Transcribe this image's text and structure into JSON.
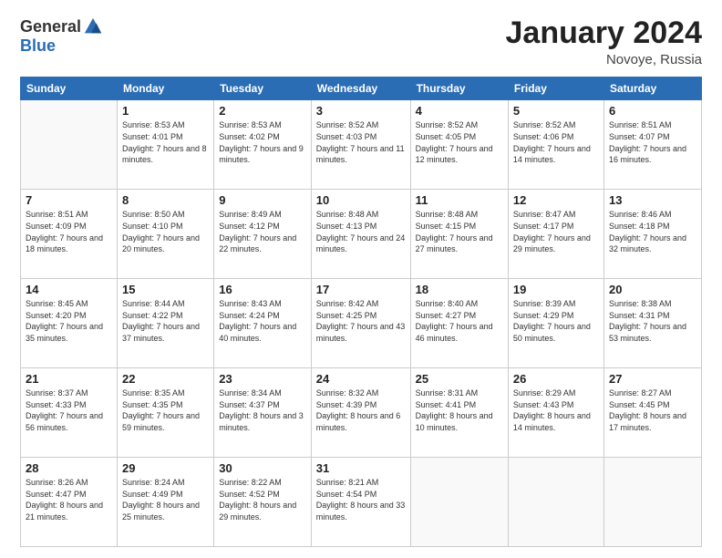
{
  "logo": {
    "general": "General",
    "blue": "Blue"
  },
  "title": "January 2024",
  "location": "Novoye, Russia",
  "days_header": [
    "Sunday",
    "Monday",
    "Tuesday",
    "Wednesday",
    "Thursday",
    "Friday",
    "Saturday"
  ],
  "weeks": [
    [
      {
        "day": "",
        "sunrise": "",
        "sunset": "",
        "daylight": ""
      },
      {
        "day": "1",
        "sunrise": "Sunrise: 8:53 AM",
        "sunset": "Sunset: 4:01 PM",
        "daylight": "Daylight: 7 hours and 8 minutes."
      },
      {
        "day": "2",
        "sunrise": "Sunrise: 8:53 AM",
        "sunset": "Sunset: 4:02 PM",
        "daylight": "Daylight: 7 hours and 9 minutes."
      },
      {
        "day": "3",
        "sunrise": "Sunrise: 8:52 AM",
        "sunset": "Sunset: 4:03 PM",
        "daylight": "Daylight: 7 hours and 11 minutes."
      },
      {
        "day": "4",
        "sunrise": "Sunrise: 8:52 AM",
        "sunset": "Sunset: 4:05 PM",
        "daylight": "Daylight: 7 hours and 12 minutes."
      },
      {
        "day": "5",
        "sunrise": "Sunrise: 8:52 AM",
        "sunset": "Sunset: 4:06 PM",
        "daylight": "Daylight: 7 hours and 14 minutes."
      },
      {
        "day": "6",
        "sunrise": "Sunrise: 8:51 AM",
        "sunset": "Sunset: 4:07 PM",
        "daylight": "Daylight: 7 hours and 16 minutes."
      }
    ],
    [
      {
        "day": "7",
        "sunrise": "Sunrise: 8:51 AM",
        "sunset": "Sunset: 4:09 PM",
        "daylight": "Daylight: 7 hours and 18 minutes."
      },
      {
        "day": "8",
        "sunrise": "Sunrise: 8:50 AM",
        "sunset": "Sunset: 4:10 PM",
        "daylight": "Daylight: 7 hours and 20 minutes."
      },
      {
        "day": "9",
        "sunrise": "Sunrise: 8:49 AM",
        "sunset": "Sunset: 4:12 PM",
        "daylight": "Daylight: 7 hours and 22 minutes."
      },
      {
        "day": "10",
        "sunrise": "Sunrise: 8:48 AM",
        "sunset": "Sunset: 4:13 PM",
        "daylight": "Daylight: 7 hours and 24 minutes."
      },
      {
        "day": "11",
        "sunrise": "Sunrise: 8:48 AM",
        "sunset": "Sunset: 4:15 PM",
        "daylight": "Daylight: 7 hours and 27 minutes."
      },
      {
        "day": "12",
        "sunrise": "Sunrise: 8:47 AM",
        "sunset": "Sunset: 4:17 PM",
        "daylight": "Daylight: 7 hours and 29 minutes."
      },
      {
        "day": "13",
        "sunrise": "Sunrise: 8:46 AM",
        "sunset": "Sunset: 4:18 PM",
        "daylight": "Daylight: 7 hours and 32 minutes."
      }
    ],
    [
      {
        "day": "14",
        "sunrise": "Sunrise: 8:45 AM",
        "sunset": "Sunset: 4:20 PM",
        "daylight": "Daylight: 7 hours and 35 minutes."
      },
      {
        "day": "15",
        "sunrise": "Sunrise: 8:44 AM",
        "sunset": "Sunset: 4:22 PM",
        "daylight": "Daylight: 7 hours and 37 minutes."
      },
      {
        "day": "16",
        "sunrise": "Sunrise: 8:43 AM",
        "sunset": "Sunset: 4:24 PM",
        "daylight": "Daylight: 7 hours and 40 minutes."
      },
      {
        "day": "17",
        "sunrise": "Sunrise: 8:42 AM",
        "sunset": "Sunset: 4:25 PM",
        "daylight": "Daylight: 7 hours and 43 minutes."
      },
      {
        "day": "18",
        "sunrise": "Sunrise: 8:40 AM",
        "sunset": "Sunset: 4:27 PM",
        "daylight": "Daylight: 7 hours and 46 minutes."
      },
      {
        "day": "19",
        "sunrise": "Sunrise: 8:39 AM",
        "sunset": "Sunset: 4:29 PM",
        "daylight": "Daylight: 7 hours and 50 minutes."
      },
      {
        "day": "20",
        "sunrise": "Sunrise: 8:38 AM",
        "sunset": "Sunset: 4:31 PM",
        "daylight": "Daylight: 7 hours and 53 minutes."
      }
    ],
    [
      {
        "day": "21",
        "sunrise": "Sunrise: 8:37 AM",
        "sunset": "Sunset: 4:33 PM",
        "daylight": "Daylight: 7 hours and 56 minutes."
      },
      {
        "day": "22",
        "sunrise": "Sunrise: 8:35 AM",
        "sunset": "Sunset: 4:35 PM",
        "daylight": "Daylight: 7 hours and 59 minutes."
      },
      {
        "day": "23",
        "sunrise": "Sunrise: 8:34 AM",
        "sunset": "Sunset: 4:37 PM",
        "daylight": "Daylight: 8 hours and 3 minutes."
      },
      {
        "day": "24",
        "sunrise": "Sunrise: 8:32 AM",
        "sunset": "Sunset: 4:39 PM",
        "daylight": "Daylight: 8 hours and 6 minutes."
      },
      {
        "day": "25",
        "sunrise": "Sunrise: 8:31 AM",
        "sunset": "Sunset: 4:41 PM",
        "daylight": "Daylight: 8 hours and 10 minutes."
      },
      {
        "day": "26",
        "sunrise": "Sunrise: 8:29 AM",
        "sunset": "Sunset: 4:43 PM",
        "daylight": "Daylight: 8 hours and 14 minutes."
      },
      {
        "day": "27",
        "sunrise": "Sunrise: 8:27 AM",
        "sunset": "Sunset: 4:45 PM",
        "daylight": "Daylight: 8 hours and 17 minutes."
      }
    ],
    [
      {
        "day": "28",
        "sunrise": "Sunrise: 8:26 AM",
        "sunset": "Sunset: 4:47 PM",
        "daylight": "Daylight: 8 hours and 21 minutes."
      },
      {
        "day": "29",
        "sunrise": "Sunrise: 8:24 AM",
        "sunset": "Sunset: 4:49 PM",
        "daylight": "Daylight: 8 hours and 25 minutes."
      },
      {
        "day": "30",
        "sunrise": "Sunrise: 8:22 AM",
        "sunset": "Sunset: 4:52 PM",
        "daylight": "Daylight: 8 hours and 29 minutes."
      },
      {
        "day": "31",
        "sunrise": "Sunrise: 8:21 AM",
        "sunset": "Sunset: 4:54 PM",
        "daylight": "Daylight: 8 hours and 33 minutes."
      },
      {
        "day": "",
        "sunrise": "",
        "sunset": "",
        "daylight": ""
      },
      {
        "day": "",
        "sunrise": "",
        "sunset": "",
        "daylight": ""
      },
      {
        "day": "",
        "sunrise": "",
        "sunset": "",
        "daylight": ""
      }
    ]
  ]
}
